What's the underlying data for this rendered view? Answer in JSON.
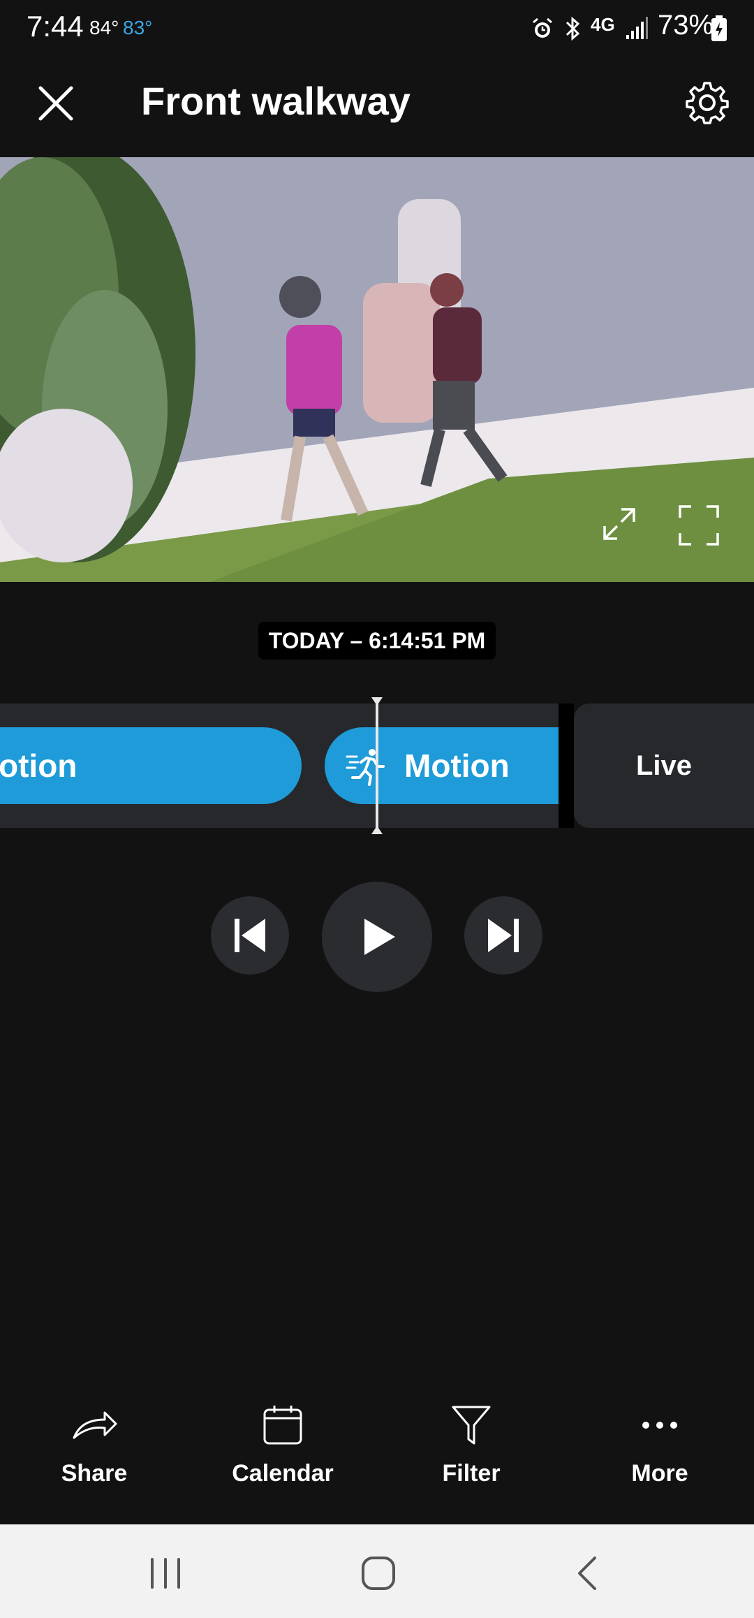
{
  "status_bar": {
    "time": "7:44",
    "temp_high": "84°",
    "temp_low": "83°",
    "network": "4G",
    "battery": "73%",
    "icons": [
      "alarm-icon",
      "bluetooth-icon",
      "4g-icon",
      "signal-icon",
      "battery-icon"
    ]
  },
  "header": {
    "title": "Front walkway",
    "left_icon": "close-icon",
    "right_icon": "gear-icon"
  },
  "video": {
    "controls": [
      "expand-icon",
      "fullscreen-icon"
    ]
  },
  "timestamp": "TODAY – 6:14:51 PM",
  "timeline": {
    "events": [
      {
        "label": "otion",
        "type": "motion"
      },
      {
        "label": "Motion",
        "type": "motion",
        "icon": "running-person-icon"
      }
    ],
    "live_label": "Live"
  },
  "playback": {
    "buttons": [
      "skip-previous-icon",
      "play-icon",
      "skip-next-icon"
    ]
  },
  "bottom_nav": {
    "share": "Share",
    "calendar": "Calendar",
    "filter": "Filter",
    "more": "More"
  },
  "system_nav": [
    "recent-apps-icon",
    "home-icon",
    "back-icon"
  ],
  "colors": {
    "accent": "#1e9bd8",
    "background": "#121212",
    "timeline_bg": "#26282c",
    "temp_low": "#3aa8e8"
  }
}
